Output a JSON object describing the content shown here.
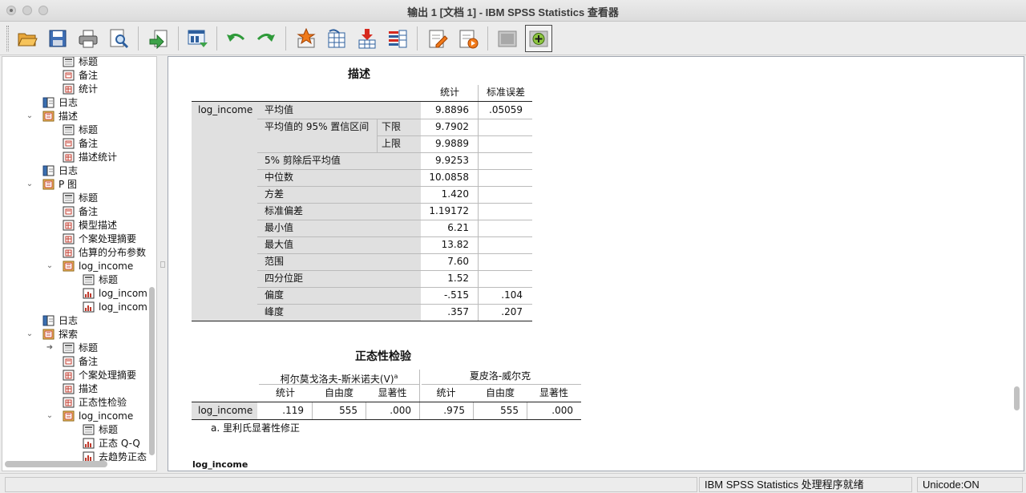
{
  "window": {
    "title": "输出 1 [文档 1] - IBM SPSS Statistics 查看器"
  },
  "toolbar": {
    "buttons": [
      {
        "name": "open-icon"
      },
      {
        "name": "save-icon"
      },
      {
        "name": "print-icon"
      },
      {
        "name": "print-preview-icon"
      },
      {
        "name": "export-icon"
      },
      {
        "name": "recall-dialog-icon"
      },
      {
        "name": "undo-icon"
      },
      {
        "name": "redo-icon"
      },
      {
        "name": "goto-data-icon"
      },
      {
        "name": "goto-case-icon"
      },
      {
        "name": "insert-variable-icon"
      },
      {
        "name": "variables-icon"
      },
      {
        "name": "edit-output-icon"
      },
      {
        "name": "script-icon"
      },
      {
        "name": "hide-icon"
      },
      {
        "name": "show-icon"
      }
    ]
  },
  "tree": {
    "items": [
      {
        "label": "标题",
        "level": 3,
        "type": "title"
      },
      {
        "label": "备注",
        "level": 3,
        "type": "notes"
      },
      {
        "label": "统计",
        "level": 3,
        "type": "table"
      },
      {
        "label": "日志",
        "level": 2,
        "type": "log"
      },
      {
        "label": "描述",
        "level": 2,
        "type": "proc",
        "toggle": "⌄"
      },
      {
        "label": "标题",
        "level": 3,
        "type": "title"
      },
      {
        "label": "备注",
        "level": 3,
        "type": "notes"
      },
      {
        "label": "描述统计",
        "level": 3,
        "type": "table"
      },
      {
        "label": "日志",
        "level": 2,
        "type": "log"
      },
      {
        "label": "P 图",
        "level": 2,
        "type": "proc",
        "toggle": "⌄"
      },
      {
        "label": "标题",
        "level": 3,
        "type": "title"
      },
      {
        "label": "备注",
        "level": 3,
        "type": "notes"
      },
      {
        "label": "模型描述",
        "level": 3,
        "type": "table"
      },
      {
        "label": "个案处理摘要",
        "level": 3,
        "type": "table"
      },
      {
        "label": "估算的分布参数",
        "level": 3,
        "type": "table"
      },
      {
        "label": "log_income",
        "level": 3,
        "type": "proc",
        "toggle": "⌄"
      },
      {
        "label": "标题",
        "level": 4,
        "type": "title"
      },
      {
        "label": "log_incom",
        "level": 4,
        "type": "chart"
      },
      {
        "label": "log_incom",
        "level": 4,
        "type": "chart"
      },
      {
        "label": "日志",
        "level": 2,
        "type": "log"
      },
      {
        "label": "探索",
        "level": 2,
        "type": "proc",
        "toggle": "⌄"
      },
      {
        "label": "标题",
        "level": 3,
        "type": "title",
        "current": true
      },
      {
        "label": "备注",
        "level": 3,
        "type": "notes"
      },
      {
        "label": "个案处理摘要",
        "level": 3,
        "type": "table"
      },
      {
        "label": "描述",
        "level": 3,
        "type": "table"
      },
      {
        "label": "正态性检验",
        "level": 3,
        "type": "table"
      },
      {
        "label": "log_income",
        "level": 3,
        "type": "proc",
        "toggle": "⌄"
      },
      {
        "label": "标题",
        "level": 4,
        "type": "title"
      },
      {
        "label": "正态 Q-Q",
        "level": 4,
        "type": "chart"
      },
      {
        "label": "去趋势正态",
        "level": 4,
        "type": "chart"
      }
    ]
  },
  "descriptives": {
    "title": "描述",
    "col_stat": "统计",
    "col_se": "标准误差",
    "variable": "log_income",
    "rows": [
      {
        "label": "平均值",
        "sub": "",
        "stat": "9.8896",
        "se": ".05059"
      },
      {
        "label": "平均值的 95% 置信区间",
        "sub": "下限",
        "stat": "9.7902",
        "se": ""
      },
      {
        "label": "",
        "sub": "上限",
        "stat": "9.9889",
        "se": ""
      },
      {
        "label": "5% 剪除后平均值",
        "sub": "",
        "stat": "9.9253",
        "se": ""
      },
      {
        "label": "中位数",
        "sub": "",
        "stat": "10.0858",
        "se": ""
      },
      {
        "label": "方差",
        "sub": "",
        "stat": "1.420",
        "se": ""
      },
      {
        "label": "标准偏差",
        "sub": "",
        "stat": "1.19172",
        "se": ""
      },
      {
        "label": "最小值",
        "sub": "",
        "stat": "6.21",
        "se": ""
      },
      {
        "label": "最大值",
        "sub": "",
        "stat": "13.82",
        "se": ""
      },
      {
        "label": "范围",
        "sub": "",
        "stat": "7.60",
        "se": ""
      },
      {
        "label": "四分位距",
        "sub": "",
        "stat": "1.52",
        "se": ""
      },
      {
        "label": "偏度",
        "sub": "",
        "stat": "-.515",
        "se": ".104"
      },
      {
        "label": "峰度",
        "sub": "",
        "stat": ".357",
        "se": ".207"
      }
    ]
  },
  "normality": {
    "title": "正态性检验",
    "group1": "柯尔莫戈洛夫-斯米诺夫(V)",
    "group1_sup": "a",
    "group2": "夏皮洛-威尔克",
    "cols": [
      "统计",
      "自由度",
      "显著性",
      "统计",
      "自由度",
      "显著性"
    ],
    "variable": "log_income",
    "values": [
      ".119",
      "555",
      ".000",
      ".975",
      "555",
      ".000"
    ],
    "footnote": "a. 里利氏显著性修正"
  },
  "next_section": "log_income",
  "status": {
    "message": "IBM SPSS Statistics 处理程序就绪",
    "unicode": "Unicode:ON"
  }
}
